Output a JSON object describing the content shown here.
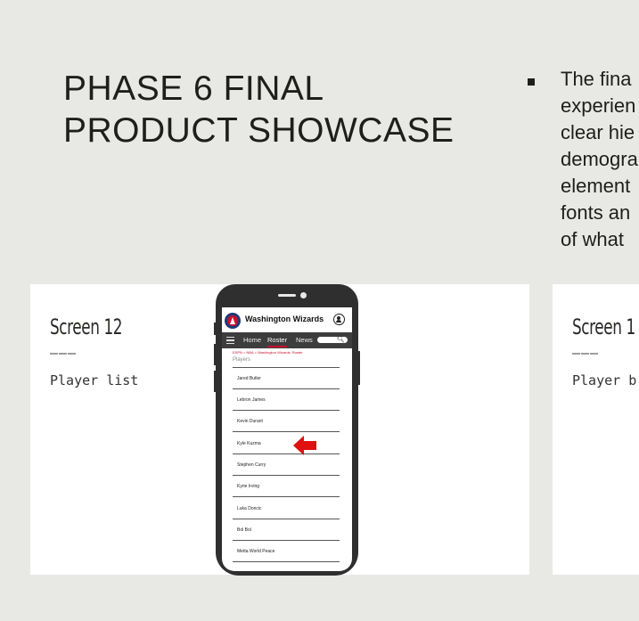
{
  "slide": {
    "title_line1": "PHASE 6 FINAL",
    "title_line2": "PRODUCT SHOWCASE",
    "bullet_lines": [
      "The fina",
      "experien",
      "clear hie",
      "demogra",
      "element",
      "fonts an",
      "of what"
    ]
  },
  "cards": [
    {
      "title": "Screen 12",
      "dashes": "———",
      "subtitle": "Player list"
    },
    {
      "title": "Screen 1",
      "dashes": "———",
      "subtitle": "Player b"
    }
  ],
  "phone_app": {
    "team_name": "Washington Wizards",
    "nav": {
      "home": "Home",
      "roster": "Roster",
      "news": "News"
    },
    "breadcrumb": "ESPN > NBA > Washington Wizards: Roster",
    "section_label": "Players",
    "players": [
      "Jared Butler",
      "Lebron James",
      "Kevin Durant",
      "Kyle Kuzma",
      "Stephen Curry",
      "Kyrie Irving",
      "Luka Doncic",
      "Bol Bol",
      "Metta World Peace"
    ],
    "icons": [
      "wizards-logo-icon",
      "user-icon",
      "hamburger-icon",
      "search-icon",
      "red-arrow-icon"
    ],
    "colors": {
      "nav_bg": "#3d3d3d",
      "accent": "#c8102e",
      "logo_blue": "#1d3a7a"
    }
  }
}
